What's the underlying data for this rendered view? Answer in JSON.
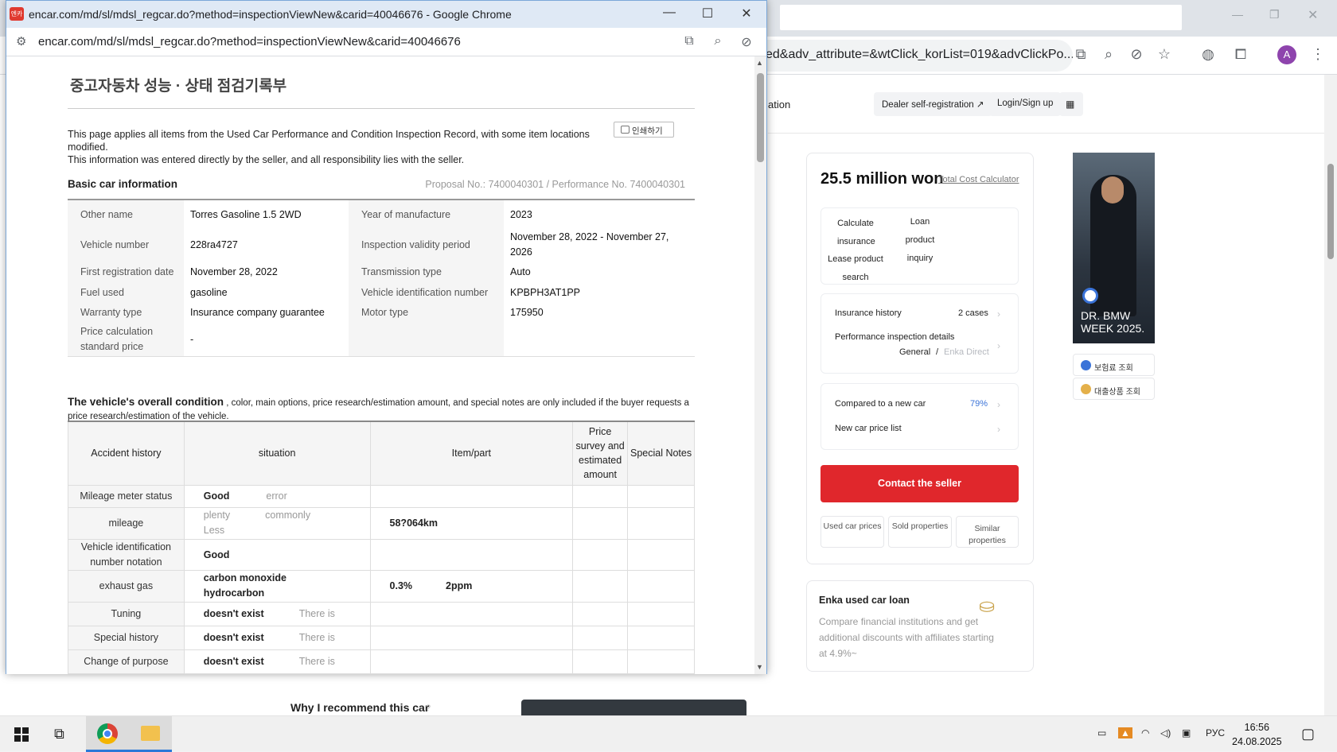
{
  "background": {
    "omnibox_url": "ed&adv_attribute=&wtClick_korList=019&advClickPo...",
    "avatar_letter": "A",
    "nav_partial": "ation",
    "dealer_button": "Dealer self-registration ↗",
    "login_button": "Login/Sign up",
    "price": "25.5 million won",
    "total_cost_link": "Total Cost Calculator",
    "calc_insurance": "Calculate insurance",
    "loan_product_inquiry": "Loan product inquiry",
    "lease_product_search": "Lease product search",
    "insurance_history_label": "Insurance history",
    "insurance_history_value": "2 cases",
    "perf_details_label": "Performance inspection details",
    "perf_general": "General",
    "perf_sep": "/",
    "perf_enka": "Enka Direct",
    "compared_label": "Compared to a new car",
    "compared_value": "79%",
    "new_car_price_list": "New car price list",
    "contact_seller": "Contact the seller",
    "used_car_prices": "Used car prices",
    "sold_properties": "Sold properties",
    "similar_properties": "Similar properties",
    "loan_title": "Enka used car loan",
    "loan_desc": "Compare financial institutions and get additional discounts with affiliates starting at 4.9%~",
    "ad_text": "DR. BMW WEEK 2025.",
    "ad_btn_insurance": "보험료 조회",
    "ad_btn_loan": "대출상품 조회",
    "recommend_title": "Why I recommend this car"
  },
  "popup": {
    "window_title": "encar.com/md/sl/mdsl_regcar.do?method=inspectionViewNew&carid=40046676 - Google Chrome",
    "favicon_text": "엔카",
    "url": "encar.com/md/sl/mdsl_regcar.do?method=inspectionViewNew&carid=40046676",
    "doc_title": "중고자동차 성능 · 상태 점검기록부",
    "print_label": "인쇄하기",
    "notice_1": "This page applies all items from the Used Car Performance and Condition Inspection Record, with some item locations",
    "notice_1b": "modified.",
    "notice_2": "This information was entered directly by the seller, and all responsibility lies with the seller.",
    "basic_title": "Basic car information",
    "proposal": "Proposal No.: 7400040301 / Performance No. 7400040301",
    "info_rows": [
      {
        "l1": "Other name",
        "v1": "Torres Gasoline 1.5 2WD",
        "l2": "Year of manufacture",
        "v2": "2023"
      },
      {
        "l1": "Vehicle number",
        "v1": "228ra4727",
        "l2": "Inspection validity period",
        "v2": "November 28, 2022 - November 27, 2026"
      },
      {
        "l1": "First registration date",
        "v1": "November 28, 2022",
        "l2": "Transmission type",
        "v2": "Auto"
      },
      {
        "l1": "Fuel used",
        "v1": "gasoline",
        "l2": "Vehicle identification number",
        "v2": "KPBPH3AT1PP"
      },
      {
        "l1": "Warranty type",
        "v1": "Insurance company guarantee",
        "l2": "Motor type",
        "v2": "175950"
      },
      {
        "l1": "Price calculation standard price",
        "v1": "-",
        "l2": "",
        "v2": ""
      }
    ],
    "overall_title": "The vehicle's overall condition",
    "overall_note": ", color, main options, price research/estimation amount, and special notes are only included if the buyer requests a price research/estimation of the vehicle.",
    "cond_headers": {
      "accident": "Accident history",
      "situation": "situation",
      "item": "Item/part",
      "price": "Price survey and estimated amount",
      "notes": "Special Notes"
    },
    "cond_rows": {
      "mileage_status": {
        "label": "Mileage meter status",
        "sel": "Good",
        "opt": "error"
      },
      "mileage": {
        "label": "mileage",
        "opt1": "plenty",
        "opt2": "commonly",
        "opt3": "Less",
        "item": "58?064km"
      },
      "vin": {
        "label": "Vehicle identification number notation",
        "sel": "Good"
      },
      "exhaust": {
        "label": "exhaust gas",
        "sel1": "carbon monoxide",
        "sel2": "hydrocarbon",
        "v1": "0.3%",
        "v2": "2ppm"
      },
      "tuning": {
        "label": "Tuning",
        "sel": "doesn't exist",
        "opt": "There is"
      },
      "special": {
        "label": "Special history",
        "sel": "doesn't exist",
        "opt": "There is"
      },
      "purpose": {
        "label": "Change of purpose",
        "sel": "doesn't exist",
        "opt": "There is"
      }
    }
  },
  "taskbar": {
    "lang": "РУС",
    "time": "16:56",
    "date": "24.08.2025"
  }
}
